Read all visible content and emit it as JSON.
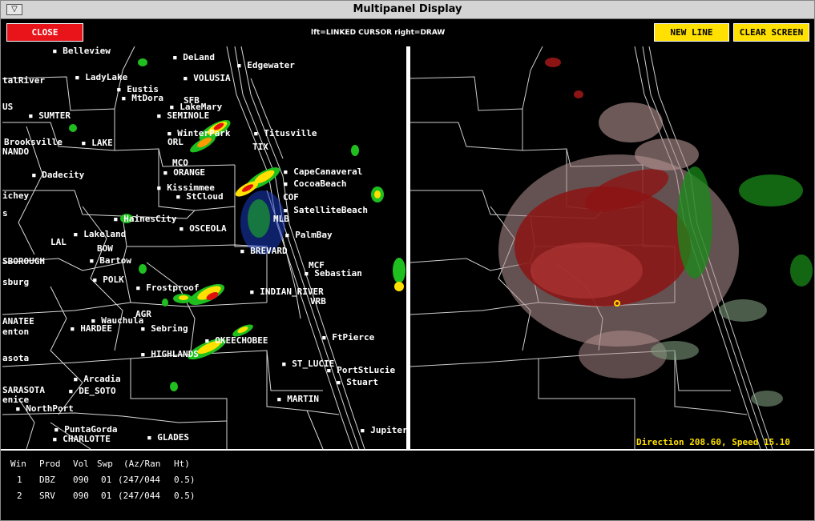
{
  "window": {
    "title": "Multipanel Display",
    "menu_glyph": "▽"
  },
  "toolbar": {
    "close_label": "CLOSE",
    "hint": "lft=LINKED CURSOR  right=DRAW",
    "new_line_label": "NEW LINE",
    "clear_screen_label": "CLEAR SCREEN"
  },
  "colors": {
    "close": "#e8141a",
    "yellow": "#ffe000",
    "title_bg": "#d4d4d4"
  },
  "left_panel": {
    "labels": [
      "Belleview",
      "DeLand",
      "Edgewater",
      "talRiver",
      "LadyLake",
      "VOLUSIA",
      "Eustis",
      "US",
      "MtDora",
      "SFB",
      "LakeMary",
      "SUMTER",
      "SEMINOLE",
      "WinterPark",
      "Titusville",
      "Brooksville",
      "LAKE",
      "ORL",
      "TIX",
      "NANDO",
      "MCO",
      "Dadecity",
      "ORANGE",
      "CapeCanaveral",
      "CocoaBeach",
      "Kissimmee",
      "StCloud",
      "COF",
      "ichey",
      "SatelliteBeach",
      "s",
      "HainesCity",
      "MLB",
      "OSCEOLA",
      "Lakeland",
      "PalmBay",
      "LAL",
      "BOW",
      "BREVARD",
      "SBOROUGH",
      "Bartow",
      "MCF",
      "Sebastian",
      "sburg",
      "POLK",
      "Frostproof",
      "INDIAN_RIVER",
      "VRB",
      "AGR",
      "ANATEE",
      "Wauchula",
      "enton",
      "HARDEE",
      "Sebring",
      "FtPierce",
      "OKEECHOBEE",
      "HIGHLANDS",
      "asota",
      "ST_LUCIE",
      "PortStLucie",
      "Arcadia",
      "Stuart",
      "SARASOTA",
      "DE_SOTO",
      "enice",
      "MARTIN",
      "NorthPort",
      "PuntaGorda",
      "Jupiter",
      "CHARLOTTE",
      "GLADES"
    ]
  },
  "right_panel": {
    "status": "Direction 208.60, Speed 15.10"
  },
  "info_table": {
    "headers": [
      "Win",
      "Prod",
      "Vol",
      "Swp",
      "(Az/Ran",
      "Ht)"
    ],
    "rows": [
      [
        "1",
        "DBZ",
        "090",
        "01",
        "(247/044",
        "0.5)"
      ],
      [
        "2",
        "SRV",
        "090",
        "01",
        "(247/044",
        "0.5)"
      ]
    ]
  }
}
